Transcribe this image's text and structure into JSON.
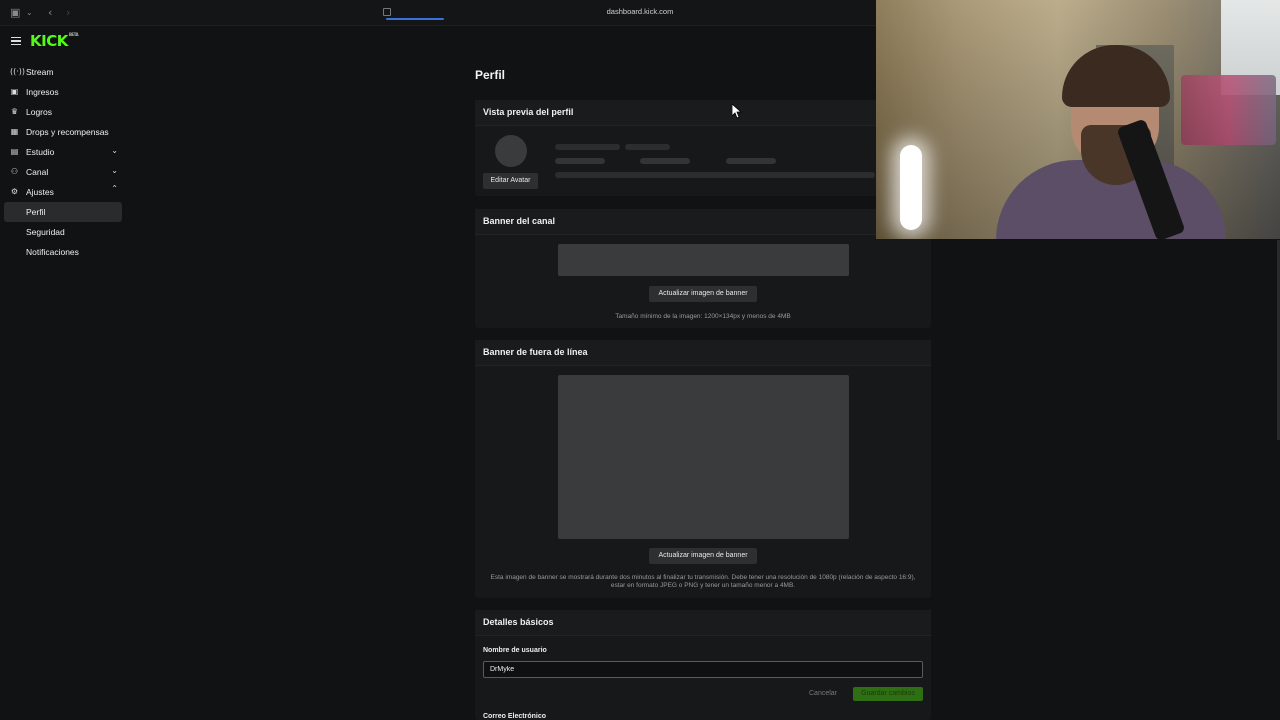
{
  "browser": {
    "url": "dashboard.kick.com"
  },
  "brand": {
    "logo": "KICK",
    "logo_badge": "BETA",
    "accent": "#53fc18"
  },
  "sidebar": {
    "items": [
      {
        "label": "Stream",
        "icon": "broadcast-icon"
      },
      {
        "label": "Ingresos",
        "icon": "wallet-icon"
      },
      {
        "label": "Logros",
        "icon": "trophy-icon"
      },
      {
        "label": "Drops y recompensas",
        "icon": "gift-icon"
      },
      {
        "label": "Estudio",
        "icon": "grid-icon"
      },
      {
        "label": "Canal",
        "icon": "users-icon"
      },
      {
        "label": "Ajustes",
        "icon": "gear-icon"
      },
      {
        "label": "Perfil"
      },
      {
        "label": "Seguridad"
      },
      {
        "label": "Notificaciones"
      }
    ]
  },
  "page": {
    "title": "Perfil"
  },
  "preview": {
    "title": "Vista previa del perfil",
    "edit_avatar": "Editar Avatar"
  },
  "channel_banner": {
    "title": "Banner del canal",
    "button": "Actualizar imagen de banner",
    "hint": "Tamaño mínimo de la imagen: 1200×134px y menos de 4MB"
  },
  "offline_banner": {
    "title": "Banner de fuera de línea",
    "button": "Actualizar imagen de banner",
    "hint": "Esta imagen de banner se mostrará durante dos minutos al finalizar tu transmisión. Debe tener una resolución de 1080p (relación de aspecto 16:9), estar en formato JPEG o PNG y tener un tamaño menor a 4MB."
  },
  "basic_details": {
    "title": "Detalles básicos",
    "username_label": "Nombre de usuario",
    "username_value": "DrMyke",
    "cancel": "Cancelar",
    "save": "Guardar cambios",
    "email_label": "Correo Electrónico"
  }
}
